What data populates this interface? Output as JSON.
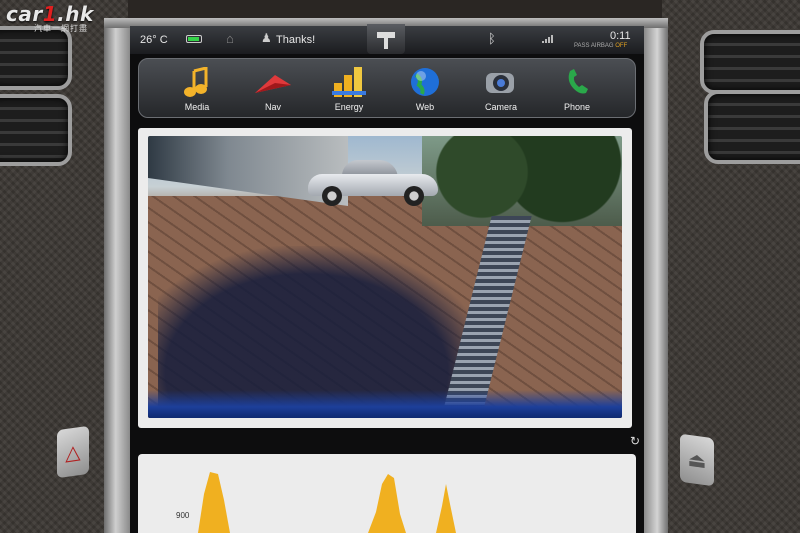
{
  "watermark": {
    "main_a": "car",
    "main_one": "1",
    "main_b": ".hk",
    "sub": "汽車一網打盡"
  },
  "statusbar": {
    "temperature": "26° C",
    "user_name": "Thanks!",
    "clock": "0:11",
    "airbag_label": "PASS AIRBAG",
    "airbag_state": "OFF",
    "battery_level": 0.9
  },
  "dock": {
    "apps": [
      {
        "label": "Media",
        "icon": "music-note-icon",
        "active": false
      },
      {
        "label": "Nav",
        "icon": "navigation-arrow-icon",
        "active": false
      },
      {
        "label": "Energy",
        "icon": "bar-chart-icon",
        "active": true
      },
      {
        "label": "Web",
        "icon": "globe-icon",
        "active": false
      },
      {
        "label": "Camera",
        "icon": "camera-icon",
        "active": true
      },
      {
        "label": "Phone",
        "icon": "phone-icon",
        "active": false
      }
    ]
  },
  "energy": {
    "y_tick_label": "900",
    "accent_color": "#f0b020"
  },
  "colors": {
    "accent_green": "#36d44a",
    "airbag_orange": "#e0a020"
  }
}
